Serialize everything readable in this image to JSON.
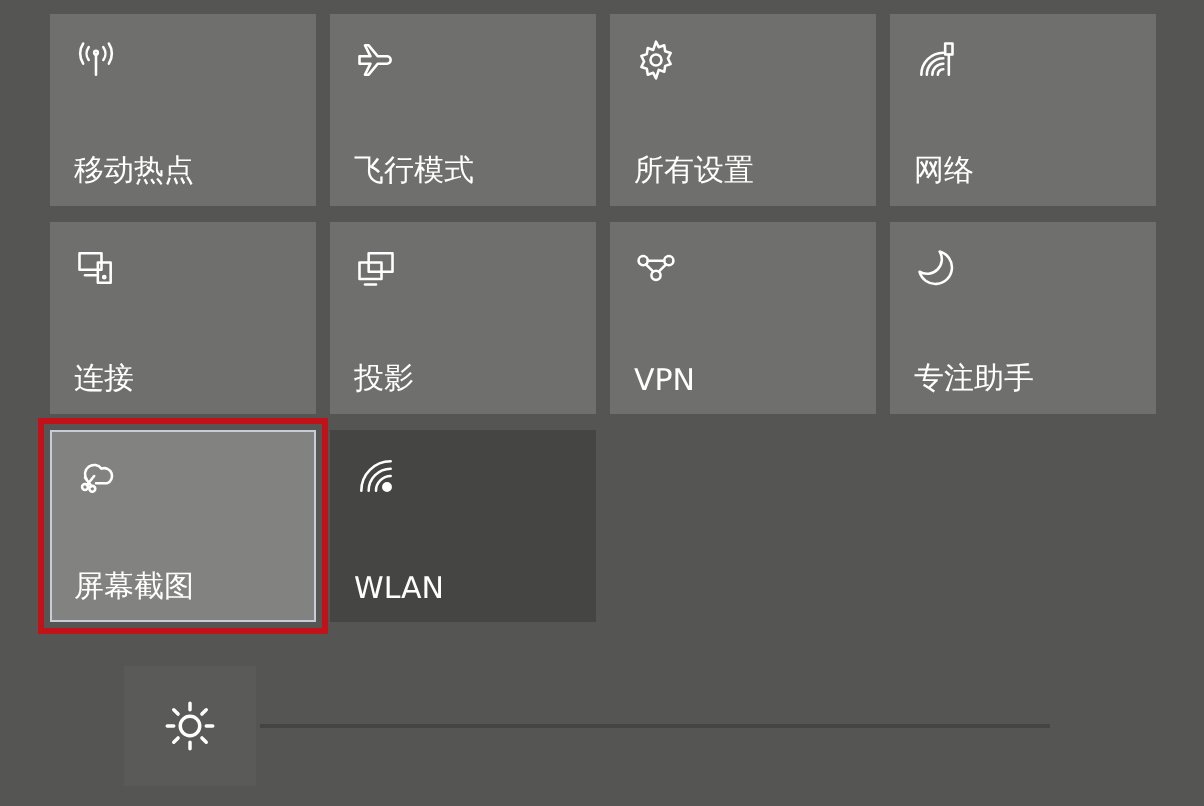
{
  "tiles": [
    {
      "label": "移动热点",
      "on": true,
      "highlighted": false
    },
    {
      "label": "飞行模式",
      "on": true,
      "highlighted": false
    },
    {
      "label": "所有设置",
      "on": true,
      "highlighted": false
    },
    {
      "label": "网络",
      "on": true,
      "highlighted": false
    },
    {
      "label": "连接",
      "on": true,
      "highlighted": false
    },
    {
      "label": "投影",
      "on": true,
      "highlighted": false
    },
    {
      "label": "VPN",
      "on": true,
      "highlighted": false
    },
    {
      "label": "专注助手",
      "on": true,
      "highlighted": false
    },
    {
      "label": "屏幕截图",
      "on": true,
      "highlighted": true
    },
    {
      "label": "WLAN",
      "on": false,
      "highlighted": false
    }
  ]
}
